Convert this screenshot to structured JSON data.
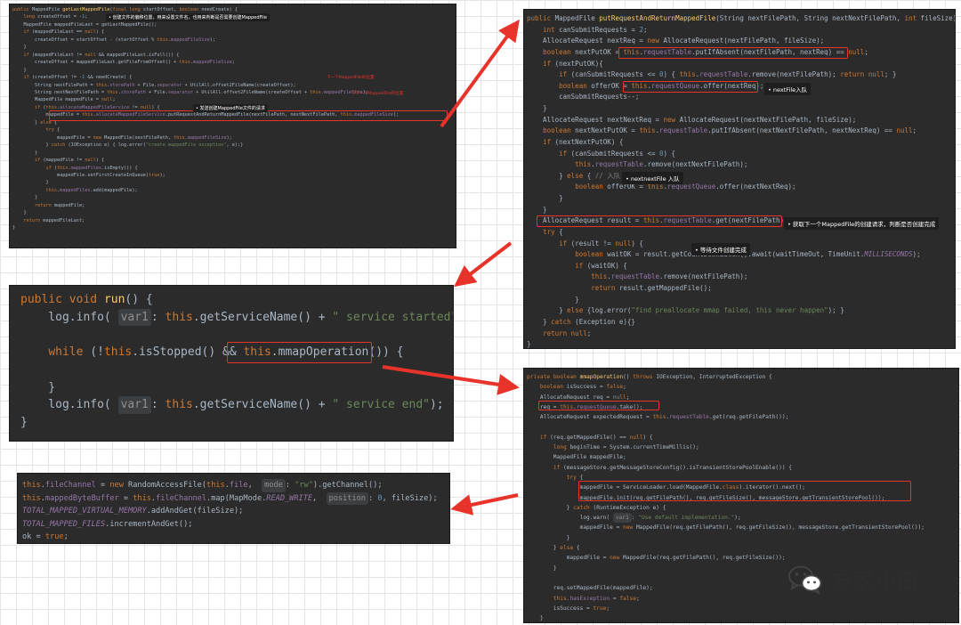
{
  "panels": {
    "get_last": {
      "lines": [
        "public MappedFile getLastMappedFile(final long startOffset, boolean needCreate) {",
        "    long createOffset = -1;",
        "    MappedFile mappedFileLast = getLastMappedFile();",
        "    if (mappedFileLast == null) {",
        "        createOffset = startOffset - (startOffset % this.mappedFileSize);",
        "    }",
        "    if (mappedFileLast != null && mappedFileLast.isFull()) {",
        "        createOffset = mappedFileLast.getFileFromOffset() + this.mappedFileSize;",
        "    }",
        "    if (createOffset != -1 && needCreate) {",
        "        String nextFilePath = this.storePath + File.separator + UtilAll.offset2FileName(createOffset);",
        "        String nextNextFilePath = this.storePath + File.separator + UtilAll.offset2FileName(createOffset + this.mappedFileSize);",
        "        MappedFile mappedFile = null;",
        "        if (this.allocateMappedFileService != null) {",
        "            mappedFile = this.allocateMappedFileService.putRequestAndReturnMappedFile(nextFilePath, nextNextFilePath, this.mappedFileSize);",
        "        } else {",
        "            try {",
        "                mappedFile = new MappedFile(nextFilePath, this.mappedFileSize);",
        "            } catch (IOException e) { log.error(\"create mappedFile exception\", e);}",
        "        }",
        "        if (mappedFile != null) {",
        "            if (this.mappedFiles.isEmpty()) {",
        "                mappedFile.setFirstCreateInQueue(true);",
        "            }",
        "            this.mappedFiles.add(mappedFile);",
        "        }",
        "        return mappedFile;",
        "    }",
        "    return mappedFileLast;",
        "}"
      ],
      "note_create_offset": "创建文件的偏移位置，用来设置文件名，也用来判断是否需要创建MappedFile",
      "label_next_file": "下一个MappedFile的位置",
      "label_next_next_file": "下下一个MappedFile的位置",
      "note_allocate_request": "发送创建MappedFile文件的请求"
    },
    "put_request": {
      "lines": [
        "public MappedFile putRequestAndReturnMappedFile(String nextFilePath, String nextNextFilePath, int fileSize) {",
        "    int canSubmitRequests = 2;",
        "    AllocateRequest nextReq = new AllocateRequest(nextFilePath, fileSize);",
        "    boolean nextPutOK = this.requestTable.putIfAbsent(nextFilePath, nextReq) == null;",
        "    if (nextPutOK){",
        "        if (canSubmitRequests <= 0) { this.requestTable.remove(nextFilePath); return null; }",
        "        boolean offerOK = this.requestQueue.offer(nextReq);",
        "        canSubmitRequests--;",
        "    }",
        "    AllocateRequest nextNextReq = new AllocateRequest(nextNextFilePath, fileSize);",
        "    boolean nextNextPutOK = this.requestTable.putIfAbsent(nextNextFilePath, nextNextReq) == null;",
        "    if (nextNextPutOK) {",
        "        if (canSubmitRequests <= 0) {",
        "            this.requestTable.remove(nextNextFilePath);",
        "        } else { // 入队",
        "            boolean offerOK = this.requestQueue.offer(nextNextReq);",
        "        }",
        "    }",
        "    AllocateRequest result = this.requestTable.get(nextFilePath);",
        "    try {",
        "        if (result != null) {",
        "            boolean waitOK = result.getCountDownLatch().await(waitTimeOut, TimeUnit.MILLISECONDS);",
        "            if (waitOK) {",
        "                this.requestTable.remove(nextFilePath);",
        "                return result.getMappedFile();",
        "            }",
        "        } else {log.error(\"find preallocate mmap failed, this never happen\"); }",
        "    } catch (Exception e){}",
        "    return null;",
        "}"
      ],
      "note_next_file_enqueue": "nextFile入队",
      "note_next_next_enqueue": "nextnextFile 入队",
      "note_get_request": "获取下一个MappedFile的创建请求，判断是否创建完成",
      "note_wait_create": "等待文件创建完成"
    },
    "run": {
      "lines": [
        "public void run() {",
        "    log.info( var1: this.getServiceName() + \" service started\");",
        "",
        "    while (!this.isStopped() && this.mmapOperation()) {",
        "",
        "    }",
        "    log.info( var1: this.getServiceName() + \" service end\");",
        "}"
      ]
    },
    "mmap_operation": {
      "lines": [
        "private boolean mmapOperation() throws IOException, InterruptedException {",
        "    boolean isSuccess = false;",
        "    AllocateRequest req = null;",
        "    req = this.requestQueue.take();",
        "    AllocateRequest expectedRequest = this.requestTable.get(req.getFilePath());",
        "",
        "    if (req.getMappedFile() == null) {",
        "        long beginTime = System.currentTimeMillis();",
        "        MappedFile mappedFile;",
        "        if (messageStore.getMessageStoreConfig().isTransientStorePoolEnable()) {",
        "            try {",
        "                mappedFile = ServiceLoader.load(MappedFile.class).iterator().next();",
        "                mappedFile.init(req.getFilePath(), req.getFileSize(), messageStore.getTransientStorePool());",
        "            } catch (RuntimeException e) {",
        "                log.warn( var1: \"Use default implementation.\");",
        "                mappedFile = new MappedFile(req.getFilePath(), req.getFileSize(), messageStore.getTransientStorePool());",
        "            }",
        "        } else {",
        "            mappedFile = new MappedFile(req.getFilePath(), req.getFileSize());",
        "        }",
        "",
        "        req.setMappedFile(mappedFile);",
        "        this.hasException = false;",
        "        isSuccess = true;",
        "    }"
      ]
    },
    "channel_map": {
      "lines": [
        "this.fileChannel = new RandomAccessFile(this.file,  mode: \"rw\").getChannel();",
        "this.mappedByteBuffer = this.fileChannel.map(MapMode.READ_WRITE,  position: 0, fileSize);",
        "TOTAL_MAPPED_VIRTUAL_MEMORY.addAndGet(fileSize);",
        "TOTAL_MAPPED_FILES.incrementAndGet();",
        "ok = true;"
      ]
    }
  },
  "watermark": {
    "text": "方家小白",
    "icon": "wechat-icon"
  },
  "colors": {
    "panel_bg": "#2b2b2b",
    "keyword": "#cc7832",
    "field": "#9876aa",
    "string": "#6a8759",
    "method": "#ffc66d",
    "number": "#6897bb",
    "highlight": "#e8332a",
    "arrow": "#e8332a"
  }
}
